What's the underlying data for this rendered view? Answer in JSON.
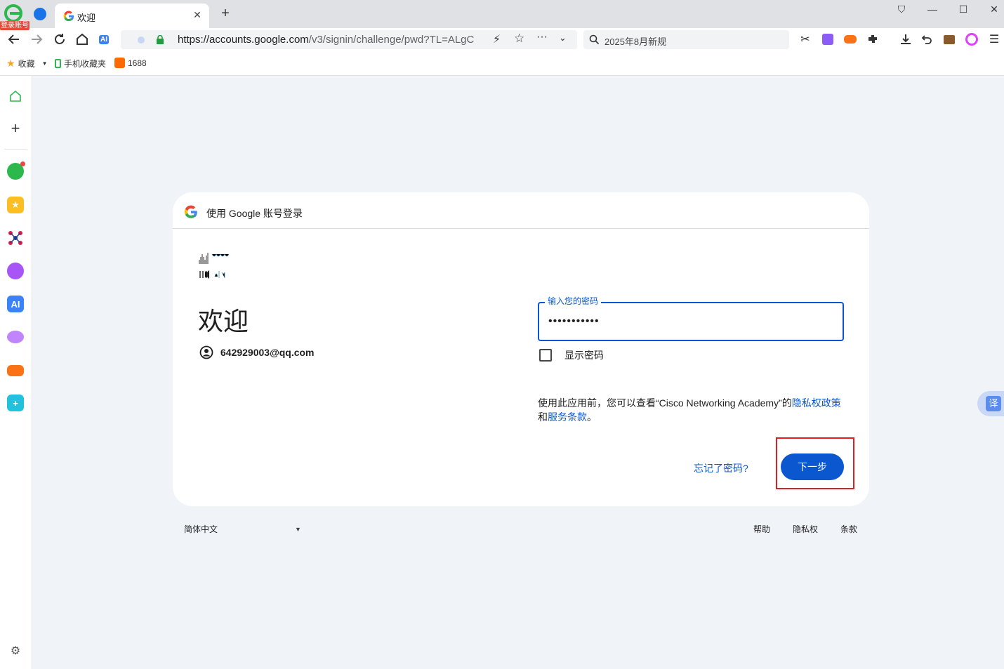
{
  "browser": {
    "login_badge": "登录账号",
    "tab": {
      "title": "欢迎",
      "close": "✕"
    },
    "new_tab": "+",
    "url": {
      "host": "https://accounts.google.com",
      "path": "/v3/signin/challenge/pwd?TL=ALgC"
    },
    "search_box": "2025年8月新规",
    "toolbar_ai": "AI",
    "bookmarks": [
      {
        "label": "收藏"
      },
      {
        "label": "手机收藏夹"
      },
      {
        "label": "1688"
      }
    ],
    "window_controls": {
      "skin": "⛉",
      "minimize": "—",
      "maximize": "☐",
      "close": "✕"
    }
  },
  "sidebar": {
    "ai_label": "AI"
  },
  "signin": {
    "header": "使用 Google 账号登录",
    "title": "欢迎",
    "email": "642929003@qq.com",
    "password_label": "输入您的密码",
    "password_mask": "•••••••••••",
    "show_password": "显示密码",
    "privacy_prefix": "使用此应用前，您可以查看“Cisco Networking Academy”的",
    "privacy_link": "隐私权政策",
    "privacy_and": "和",
    "terms_link": "服务条款",
    "privacy_suffix": "。",
    "forgot_password": "忘记了密码?",
    "next_button": "下一步"
  },
  "footer": {
    "language": "简体中文",
    "help": "帮助",
    "privacy": "隐私权",
    "terms": "条款"
  },
  "translate_fab": "译",
  "colors": {
    "accent": "#0b57d0",
    "highlight": "#e02020",
    "page_bg": "#f0f4f9"
  }
}
